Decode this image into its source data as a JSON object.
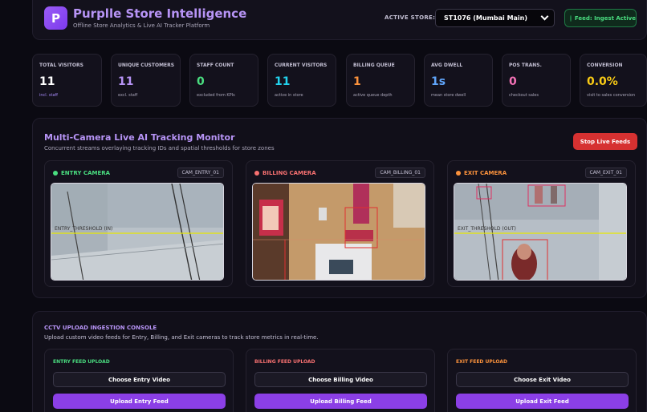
{
  "header": {
    "logo_letter": "P",
    "title": "Purplle Store Intelligence",
    "subtitle": "Offline Store Analytics & Live AI Tracker Platform",
    "active_store_label": "ACTIVE STORE:",
    "active_store_value": "ST1076 (Mumbai Main)",
    "feed_status": "Feed: Ingest Active"
  },
  "kpis": [
    {
      "label": "TOTAL VISITORS",
      "value": "11",
      "sub": "incl. staff",
      "color": "#ffffff",
      "sub_color": "#a78bfa"
    },
    {
      "label": "UNIQUE CUSTOMERS",
      "value": "11",
      "sub": "excl. staff",
      "color": "#b794f6",
      "sub_color": "#a9a5b8"
    },
    {
      "label": "STAFF COUNT",
      "value": "0",
      "sub": "excluded from KPIs",
      "color": "#4ade80",
      "sub_color": "#a9a5b8"
    },
    {
      "label": "CURRENT VISITORS",
      "value": "11",
      "sub": "active in store",
      "color": "#22d3ee",
      "sub_color": "#a9a5b8"
    },
    {
      "label": "BILLING QUEUE",
      "value": "1",
      "sub": "active queue depth",
      "color": "#fb923c",
      "sub_color": "#a9a5b8"
    },
    {
      "label": "AVG DWELL",
      "value": "1s",
      "sub": "mean store dwell",
      "color": "#60a5fa",
      "sub_color": "#a9a5b8"
    },
    {
      "label": "POS TRANS.",
      "value": "0",
      "sub": "checkout sales",
      "color": "#f472b6",
      "sub_color": "#a9a5b8"
    },
    {
      "label": "CONVERSION",
      "value": "0.0%",
      "sub": "visit to sales conversion",
      "color": "#facc15",
      "sub_color": "#a9a5b8"
    }
  ],
  "monitor": {
    "title": "Multi-Camera Live AI Tracking Monitor",
    "subtitle": "Concurrent streams overlaying tracking IDs and spatial thresholds for store zones",
    "stop_label": "Stop Live Feeds",
    "cameras": [
      {
        "name": "ENTRY CAMERA",
        "id": "CAM_ENTRY_01",
        "color": "#4ade80",
        "threshold": "ENTRY_THRESHOLD (IN)"
      },
      {
        "name": "BILLING CAMERA",
        "id": "CAM_BILLING_01",
        "color": "#f87171"
      },
      {
        "name": "EXIT CAMERA",
        "id": "CAM_EXIT_01",
        "color": "#fb923c",
        "threshold": "EXIT_THRESHOLD (OUT)"
      }
    ]
  },
  "upload": {
    "title": "CCTV UPLOAD INGESTION CONSOLE",
    "subtitle": "Upload custom video feeds for Entry, Billing, and Exit cameras to track store metrics in real-time.",
    "cards": [
      {
        "label": "ENTRY FEED UPLOAD",
        "choose": "Choose Entry Video",
        "upload": "Upload Entry Feed",
        "color": "#4ade80"
      },
      {
        "label": "BILLING FEED UPLOAD",
        "choose": "Choose Billing Video",
        "upload": "Upload Billing Feed",
        "color": "#f87171"
      },
      {
        "label": "EXIT FEED UPLOAD",
        "choose": "Choose Exit Video",
        "upload": "Upload Exit Feed",
        "color": "#fb923c"
      }
    ]
  }
}
